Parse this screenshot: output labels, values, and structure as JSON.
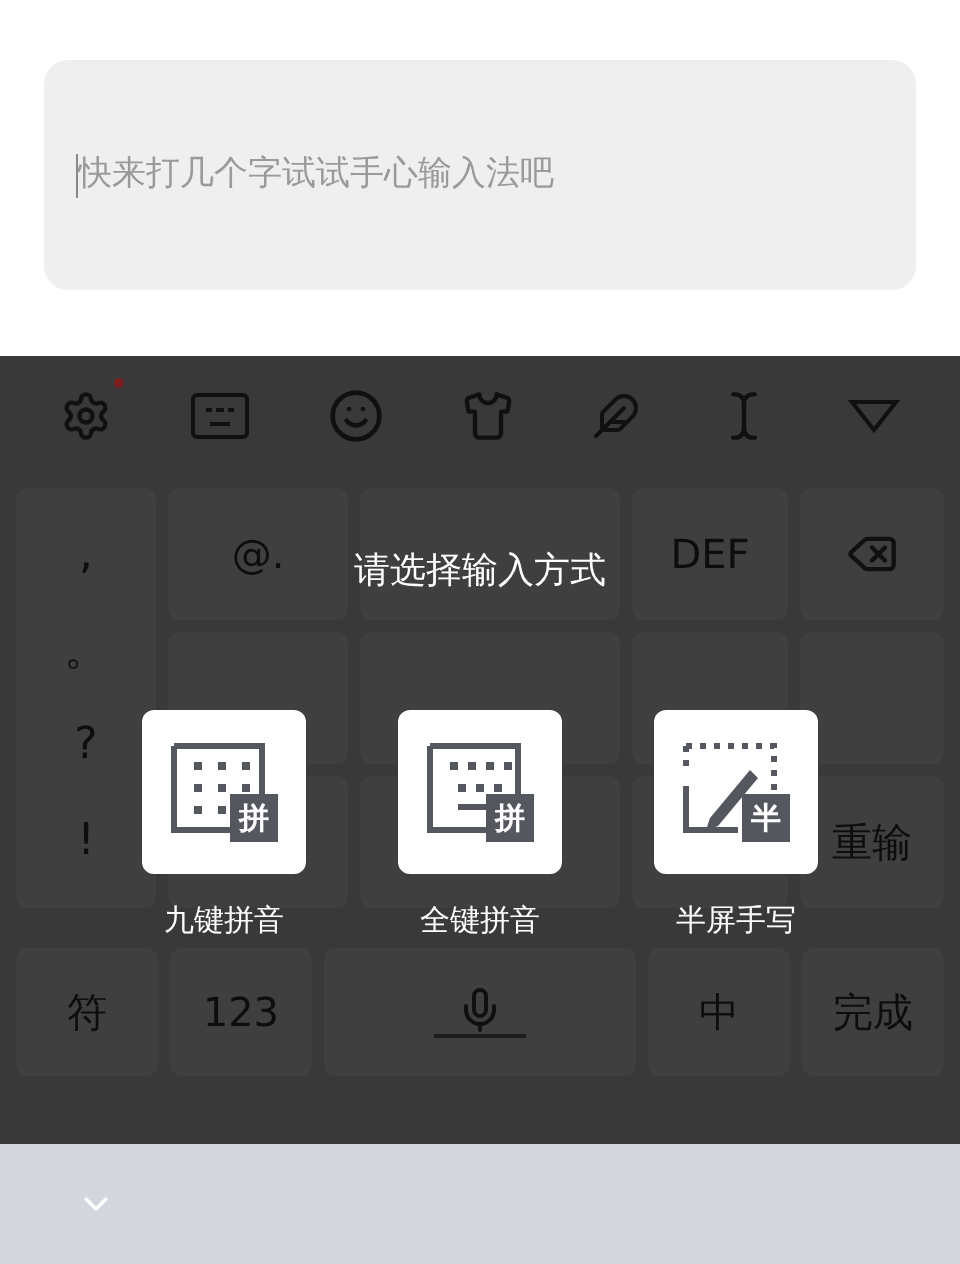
{
  "input": {
    "placeholder": "快来打几个字试试手心输入法吧",
    "focused": true
  },
  "toolbar": {
    "settings_dot": true
  },
  "keyboard": {
    "symbols": [
      ",",
      "。",
      "?",
      "!"
    ],
    "rows": [
      [
        {
          "label": "@."
        },
        {},
        {
          "label": "DEF"
        },
        {
          "kind": "backspace"
        }
      ],
      [
        {},
        {},
        {},
        {}
      ],
      [
        {},
        {},
        {},
        {
          "label": "重输"
        }
      ]
    ],
    "bottom_row": [
      {
        "label": "符"
      },
      {
        "label": "123"
      },
      {
        "kind": "space"
      },
      {
        "label": "中"
      },
      {
        "label": "完成"
      }
    ]
  },
  "dialog": {
    "title": "请选择输入方式",
    "options": [
      {
        "kind": "nine_key",
        "label": "九键拼音",
        "badge": "拼"
      },
      {
        "kind": "full_key",
        "label": "全键拼音",
        "badge": "拼"
      },
      {
        "kind": "handwriting",
        "label": "半屏手写",
        "badge": "半"
      }
    ]
  }
}
